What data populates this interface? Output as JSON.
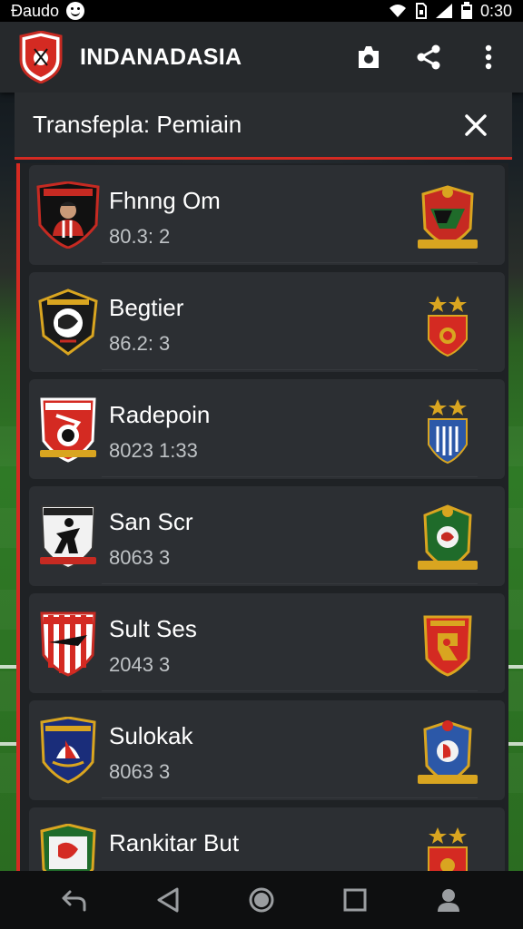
{
  "status_bar": {
    "left_text": "Đaudo",
    "time": "0:30",
    "icons": [
      "smiley-icon",
      "wifi-icon",
      "sim-icon",
      "signal-icon",
      "battery-icon"
    ]
  },
  "app_bar": {
    "title": "INDANADASIA",
    "actions": [
      "camera-icon",
      "share-icon",
      "more-vert-icon"
    ]
  },
  "panel": {
    "title": "Transfepla: Pemiain",
    "close_icon": "close-icon"
  },
  "players": [
    {
      "name": "Fhnng Om",
      "value": "80.3: 2"
    },
    {
      "name": "Begtier",
      "value": "86.2: 3"
    },
    {
      "name": "Radepoin",
      "value": "8023 1:33"
    },
    {
      "name": "San Scr",
      "value": "8063 3"
    },
    {
      "name": "Sult Ses",
      "value": "2043 3"
    },
    {
      "name": "Sulokak",
      "value": "8063 3"
    },
    {
      "name": "Rankitar But",
      "value": ""
    }
  ],
  "nav_bar": [
    "back-icon",
    "triangle-back-icon",
    "home-icon",
    "recents-icon",
    "person-icon"
  ],
  "colors": {
    "accent": "#d42a22",
    "app_bar": "#26292c",
    "card": "#2c2f33",
    "gold": "#d9a520"
  }
}
